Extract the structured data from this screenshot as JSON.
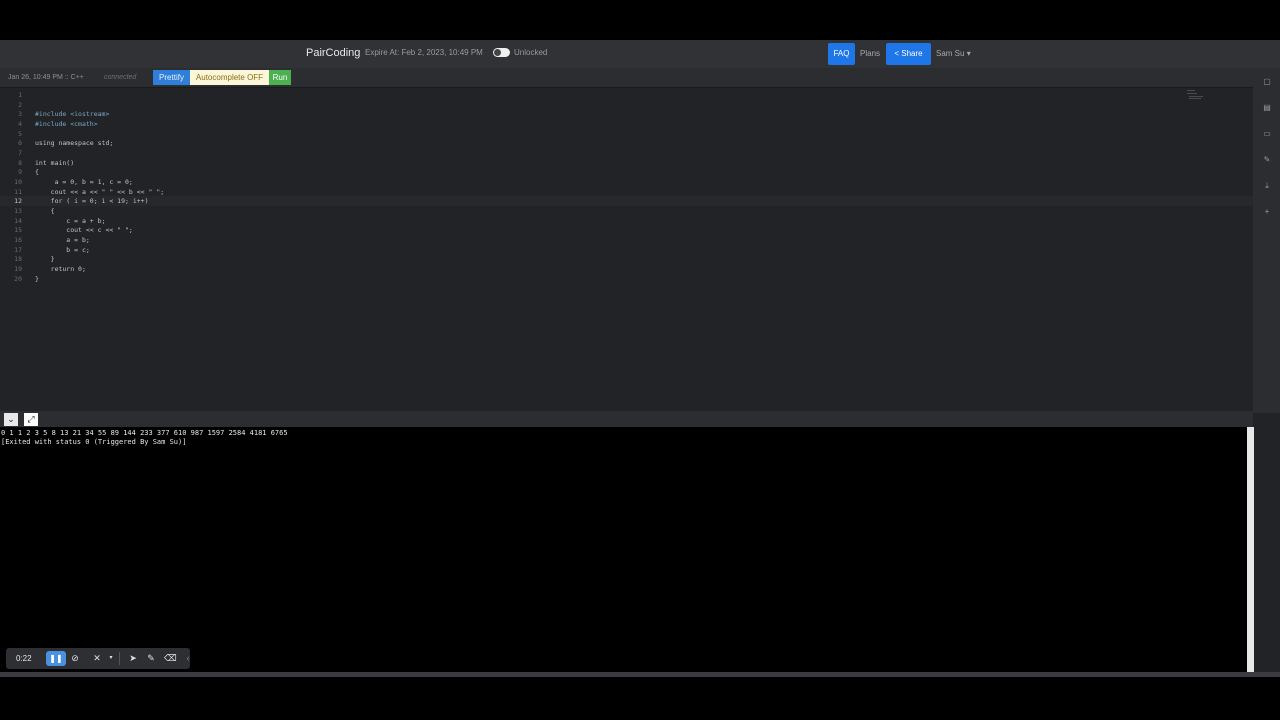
{
  "navbar": {
    "brand": "PairCoding",
    "expire": "Expire At: Feb 2, 2023, 10:49 PM",
    "lock_state": "Unlocked",
    "faq": "FAQ",
    "plans": "Plans",
    "share": "Share",
    "user": "Sam Su"
  },
  "toolbar": {
    "meta": "Jan 26, 10:49 PM :: C++",
    "status": "connected",
    "prettify": "Prettify",
    "autocomplete": "Autocomplete OFF",
    "run": "Run"
  },
  "editor": {
    "lines": [
      {
        "n": "1",
        "code": ""
      },
      {
        "n": "2",
        "code": ""
      },
      {
        "n": "3",
        "code": "#include <iostream>"
      },
      {
        "n": "4",
        "code": "#include <cmath>"
      },
      {
        "n": "5",
        "code": ""
      },
      {
        "n": "6",
        "code": "using namespace std;"
      },
      {
        "n": "7",
        "code": ""
      },
      {
        "n": "8",
        "code": "int main()"
      },
      {
        "n": "9",
        "code": "{"
      },
      {
        "n": "10",
        "code": "     a = 0, b = 1, c = 0;"
      },
      {
        "n": "11",
        "code": "    cout << a << \" \" << b << \" \";"
      },
      {
        "n": "12",
        "code": "    for ( i = 0; i < 19; i++)"
      },
      {
        "n": "13",
        "code": "    {"
      },
      {
        "n": "14",
        "code": "        c = a + b;"
      },
      {
        "n": "15",
        "code": "        cout << c << \" \";"
      },
      {
        "n": "16",
        "code": "        a = b;"
      },
      {
        "n": "17",
        "code": "        b = c;"
      },
      {
        "n": "18",
        "code": "    }"
      },
      {
        "n": "19",
        "code": "    return 0;"
      },
      {
        "n": "20",
        "code": "}"
      }
    ],
    "active_line": "12"
  },
  "console": {
    "lines": [
      "0 1 1 2 3 5 8 13 21 34 55 89 144 233 377 610 987 1597 2584 4181 6765",
      "[Exited with status 0 (Triggered By Sam Su)]"
    ]
  },
  "recorder": {
    "time": "0:22"
  },
  "colors": {
    "accent": "#1e76e8",
    "run": "#4caf50",
    "autocomplete_bg": "#fbf7d8"
  }
}
